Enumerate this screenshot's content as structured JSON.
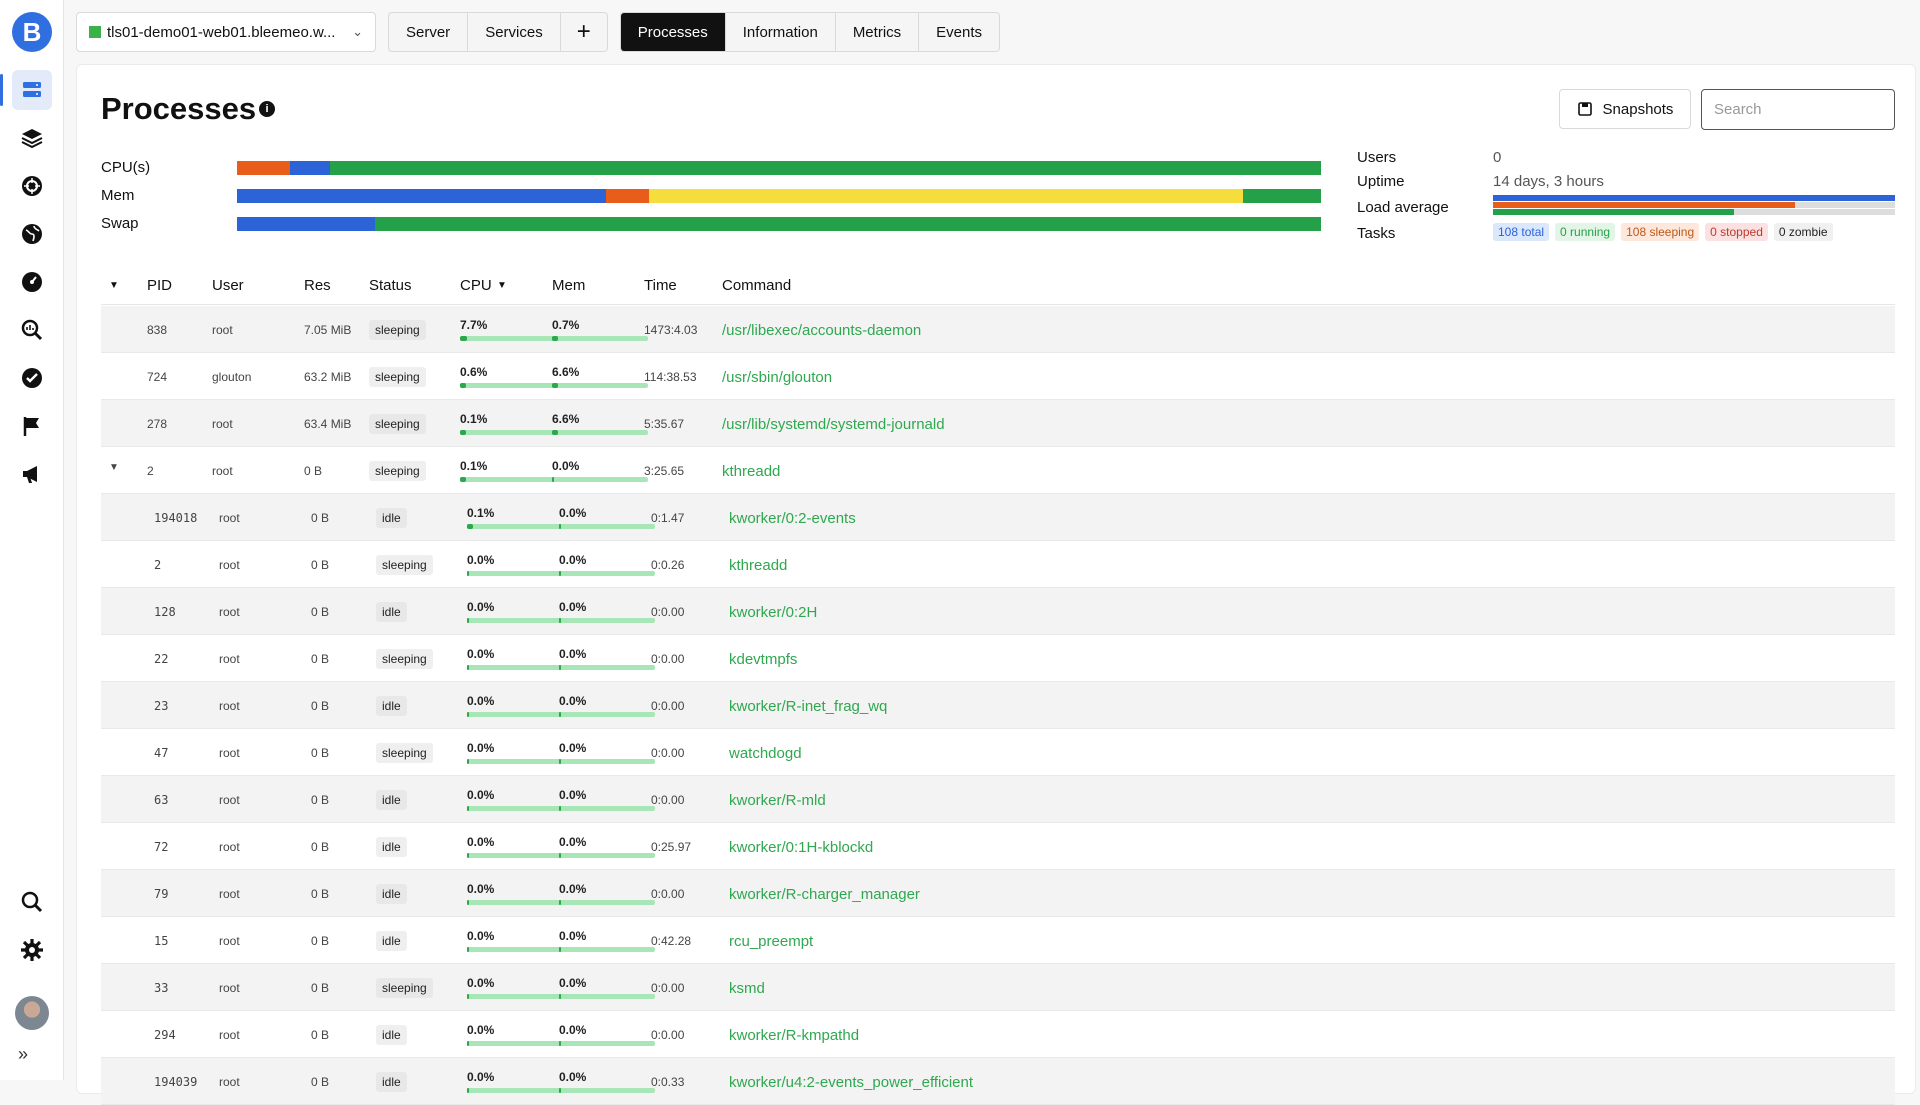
{
  "app": {
    "logo_letter": "B"
  },
  "server": {
    "name": "tls01-demo01-web01.bleemeo.w..."
  },
  "tabs_left": [
    "Server",
    "Services"
  ],
  "tabs_right": [
    "Processes",
    "Information",
    "Metrics",
    "Events"
  ],
  "page": {
    "title": "Processes",
    "snapshots_label": "Snapshots",
    "search_placeholder": "Search"
  },
  "meters": {
    "cpu_label": "CPU(s)",
    "mem_label": "Mem",
    "swap_label": "Swap",
    "cpu": [
      {
        "color": "#e85d1a",
        "frac": 0.049
      },
      {
        "color": "#2c63d6",
        "frac": 0.037
      },
      {
        "color": "#24a148",
        "frac": 0.914
      }
    ],
    "mem": [
      {
        "color": "#2c63d6",
        "frac": 0.34
      },
      {
        "color": "#e85d1a",
        "frac": 0.04
      },
      {
        "color": "#f5dd3d",
        "frac": 0.548
      },
      {
        "color": "#24a148",
        "frac": 0.072
      }
    ],
    "swap": [
      {
        "color": "#2c63d6",
        "frac": 0.127
      },
      {
        "color": "#24a148",
        "frac": 0.873
      }
    ]
  },
  "stats": {
    "users_label": "Users",
    "users": "0",
    "uptime_label": "Uptime",
    "uptime": "14 days, 3 hours",
    "load_label": "Load average",
    "tasks_label": "Tasks",
    "load_bars": [
      [
        {
          "color": "#2c63d6",
          "frac": 1.0
        }
      ],
      [
        {
          "color": "#e85d1a",
          "frac": 0.75
        },
        {
          "color": "#dddddd",
          "frac": 0.25
        }
      ],
      [
        {
          "color": "#24a148",
          "frac": 0.6
        },
        {
          "color": "#dddddd",
          "frac": 0.4
        }
      ]
    ],
    "tasks": {
      "total": "108 total",
      "running": "0 running",
      "sleeping": "108 sleeping",
      "stopped": "0 stopped",
      "zombie": "0 zombie"
    }
  },
  "columns": {
    "pid": "PID",
    "user": "User",
    "res": "Res",
    "status": "Status",
    "cpu": "CPU",
    "mem": "Mem",
    "time": "Time",
    "command": "Command"
  },
  "processes": [
    {
      "pid": "838",
      "user": "root",
      "res": "7.05 MiB",
      "status": "sleeping",
      "cpu": "7.7%",
      "cpu_frac": 0.077,
      "mem": "0.7%",
      "mem_frac": 0.007,
      "time": "1473:4.03",
      "command": "/usr/libexec/accounts-daemon",
      "child": false,
      "caret": false
    },
    {
      "pid": "724",
      "user": "glouton",
      "res": "63.2 MiB",
      "status": "sleeping",
      "cpu": "0.6%",
      "cpu_frac": 0.006,
      "mem": "6.6%",
      "mem_frac": 0.066,
      "time": "114:38.53",
      "command": "/usr/sbin/glouton",
      "child": false,
      "caret": false
    },
    {
      "pid": "278",
      "user": "root",
      "res": "63.4 MiB",
      "status": "sleeping",
      "cpu": "0.1%",
      "cpu_frac": 0.001,
      "mem": "6.6%",
      "mem_frac": 0.066,
      "time": "5:35.67",
      "command": "/usr/lib/systemd/systemd-journald",
      "child": false,
      "caret": false
    },
    {
      "pid": "2",
      "user": "root",
      "res": "0 B",
      "status": "sleeping",
      "cpu": "0.1%",
      "cpu_frac": 0.001,
      "mem": "0.0%",
      "mem_frac": 0,
      "time": "3:25.65",
      "command": "kthreadd",
      "child": false,
      "caret": true
    },
    {
      "pid": "194018",
      "user": "root",
      "res": "0 B",
      "status": "idle",
      "cpu": "0.1%",
      "cpu_frac": 0.001,
      "mem": "0.0%",
      "mem_frac": 0,
      "time": "0:1.47",
      "command": "kworker/0:2-events",
      "child": true,
      "caret": false
    },
    {
      "pid": "2",
      "user": "root",
      "res": "0 B",
      "status": "sleeping",
      "cpu": "0.0%",
      "cpu_frac": 0,
      "mem": "0.0%",
      "mem_frac": 0,
      "time": "0:0.26",
      "command": "kthreadd",
      "child": true,
      "caret": false
    },
    {
      "pid": "128",
      "user": "root",
      "res": "0 B",
      "status": "idle",
      "cpu": "0.0%",
      "cpu_frac": 0,
      "mem": "0.0%",
      "mem_frac": 0,
      "time": "0:0.00",
      "command": "kworker/0:2H",
      "child": true,
      "caret": false
    },
    {
      "pid": "22",
      "user": "root",
      "res": "0 B",
      "status": "sleeping",
      "cpu": "0.0%",
      "cpu_frac": 0,
      "mem": "0.0%",
      "mem_frac": 0,
      "time": "0:0.00",
      "command": "kdevtmpfs",
      "child": true,
      "caret": false
    },
    {
      "pid": "23",
      "user": "root",
      "res": "0 B",
      "status": "idle",
      "cpu": "0.0%",
      "cpu_frac": 0,
      "mem": "0.0%",
      "mem_frac": 0,
      "time": "0:0.00",
      "command": "kworker/R-inet_frag_wq",
      "child": true,
      "caret": false
    },
    {
      "pid": "47",
      "user": "root",
      "res": "0 B",
      "status": "sleeping",
      "cpu": "0.0%",
      "cpu_frac": 0,
      "mem": "0.0%",
      "mem_frac": 0,
      "time": "0:0.00",
      "command": "watchdogd",
      "child": true,
      "caret": false
    },
    {
      "pid": "63",
      "user": "root",
      "res": "0 B",
      "status": "idle",
      "cpu": "0.0%",
      "cpu_frac": 0,
      "mem": "0.0%",
      "mem_frac": 0,
      "time": "0:0.00",
      "command": "kworker/R-mld",
      "child": true,
      "caret": false
    },
    {
      "pid": "72",
      "user": "root",
      "res": "0 B",
      "status": "idle",
      "cpu": "0.0%",
      "cpu_frac": 0,
      "mem": "0.0%",
      "mem_frac": 0,
      "time": "0:25.97",
      "command": "kworker/0:1H-kblockd",
      "child": true,
      "caret": false
    },
    {
      "pid": "79",
      "user": "root",
      "res": "0 B",
      "status": "idle",
      "cpu": "0.0%",
      "cpu_frac": 0,
      "mem": "0.0%",
      "mem_frac": 0,
      "time": "0:0.00",
      "command": "kworker/R-charger_manager",
      "child": true,
      "caret": false
    },
    {
      "pid": "15",
      "user": "root",
      "res": "0 B",
      "status": "idle",
      "cpu": "0.0%",
      "cpu_frac": 0,
      "mem": "0.0%",
      "mem_frac": 0,
      "time": "0:42.28",
      "command": "rcu_preempt",
      "child": true,
      "caret": false
    },
    {
      "pid": "33",
      "user": "root",
      "res": "0 B",
      "status": "sleeping",
      "cpu": "0.0%",
      "cpu_frac": 0,
      "mem": "0.0%",
      "mem_frac": 0,
      "time": "0:0.00",
      "command": "ksmd",
      "child": true,
      "caret": false
    },
    {
      "pid": "294",
      "user": "root",
      "res": "0 B",
      "status": "idle",
      "cpu": "0.0%",
      "cpu_frac": 0,
      "mem": "0.0%",
      "mem_frac": 0,
      "time": "0:0.00",
      "command": "kworker/R-kmpathd",
      "child": true,
      "caret": false
    },
    {
      "pid": "194039",
      "user": "root",
      "res": "0 B",
      "status": "idle",
      "cpu": "0.0%",
      "cpu_frac": 0,
      "mem": "0.0%",
      "mem_frac": 0,
      "time": "0:0.33",
      "command": "kworker/u4:2-events_power_efficient",
      "child": true,
      "caret": false
    }
  ],
  "colors": {
    "accent": "#2f6fe0",
    "command": "#2fa84f",
    "bar_bg": "#a8e6b8",
    "bar_fill": "#2aa84a"
  }
}
